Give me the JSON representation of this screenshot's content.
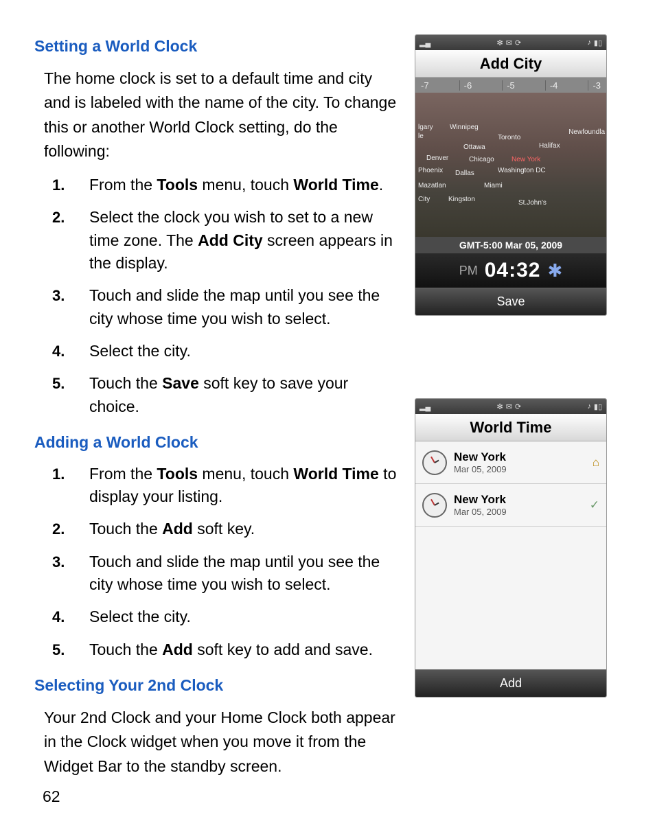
{
  "page_number": "62",
  "section1": {
    "heading": "Setting a World Clock",
    "intro": "The home clock is set to a default time and city and is labeled with the name of the city. To change this or another World Clock setting, do the following:",
    "steps": [
      {
        "n": "1.",
        "pre": "From the ",
        "b1": "Tools",
        "mid": " menu, touch ",
        "b2": "World Time",
        "post": "."
      },
      {
        "n": "2.",
        "pre": "Select the clock you wish to set to a new time zone. The ",
        "b1": "Add City",
        "mid": " screen appears in the display.",
        "b2": "",
        "post": ""
      },
      {
        "n": "3.",
        "pre": "Touch and slide the map until you see the city whose time you wish to select.",
        "b1": "",
        "mid": "",
        "b2": "",
        "post": ""
      },
      {
        "n": "4.",
        "pre": "Select the city.",
        "b1": "",
        "mid": "",
        "b2": "",
        "post": ""
      },
      {
        "n": "5.",
        "pre": "Touch the ",
        "b1": "Save",
        "mid": " soft key to save your choice.",
        "b2": "",
        "post": ""
      }
    ]
  },
  "section2": {
    "heading": "Adding a World Clock",
    "steps": [
      {
        "n": "1.",
        "pre": "From the ",
        "b1": "Tools",
        "mid": " menu, touch  ",
        "b2": "World Time",
        "post": " to display your listing."
      },
      {
        "n": "2.",
        "pre": "Touch the ",
        "b1": "Add",
        "mid": " soft key.",
        "b2": "",
        "post": ""
      },
      {
        "n": "3.",
        "pre": "Touch and slide the map until you see the city whose time you wish to select.",
        "b1": "",
        "mid": "",
        "b2": "",
        "post": ""
      },
      {
        "n": "4.",
        "pre": "Select the city.",
        "b1": "",
        "mid": "",
        "b2": "",
        "post": ""
      },
      {
        "n": "5.",
        "pre": "Touch the ",
        "b1": "Add",
        "mid": " soft key to add and save.",
        "b2": "",
        "post": ""
      }
    ]
  },
  "section3": {
    "heading": "Selecting Your 2nd Clock",
    "intro": "Your 2nd Clock and your Home Clock both appear in the Clock widget when you move it from the Widget Bar to the standby screen."
  },
  "phone1": {
    "title": "Add City",
    "tz": [
      "-7",
      "-6",
      "-5",
      "-4",
      "-3"
    ],
    "cities": {
      "c1": "lgary",
      "c2": "le",
      "c3": "Winnipeg",
      "c4": "Toronto",
      "c5": "Newfoundla",
      "c6": "Ottawa",
      "c7": "Halifax",
      "c8": "Denver",
      "c9": "Chicago",
      "c10": "New York",
      "c11": "Phoenix",
      "c12": "Dallas",
      "c13": "Washington DC",
      "c14": "Mazatlan",
      "c15": "Miami",
      "c16": "City",
      "c17": "Kingston",
      "c18": "St.John's"
    },
    "gmt": "GMT-5:00 Mar 05, 2009",
    "pm": "PM",
    "time": "04:32",
    "dst": "✱",
    "softkey": "Save"
  },
  "phone2": {
    "title": "World Time",
    "rows": [
      {
        "city": "New York",
        "date": "Mar 05, 2009",
        "icon": "home"
      },
      {
        "city": "New York",
        "date": "Mar 05, 2009",
        "icon": "check"
      }
    ],
    "softkey": "Add"
  },
  "status_icons": {
    "sig": "▂▄",
    "bt": "✻",
    "msg": "✉",
    "ref": "⟳",
    "note": "♪",
    "bat": "▮▯"
  }
}
